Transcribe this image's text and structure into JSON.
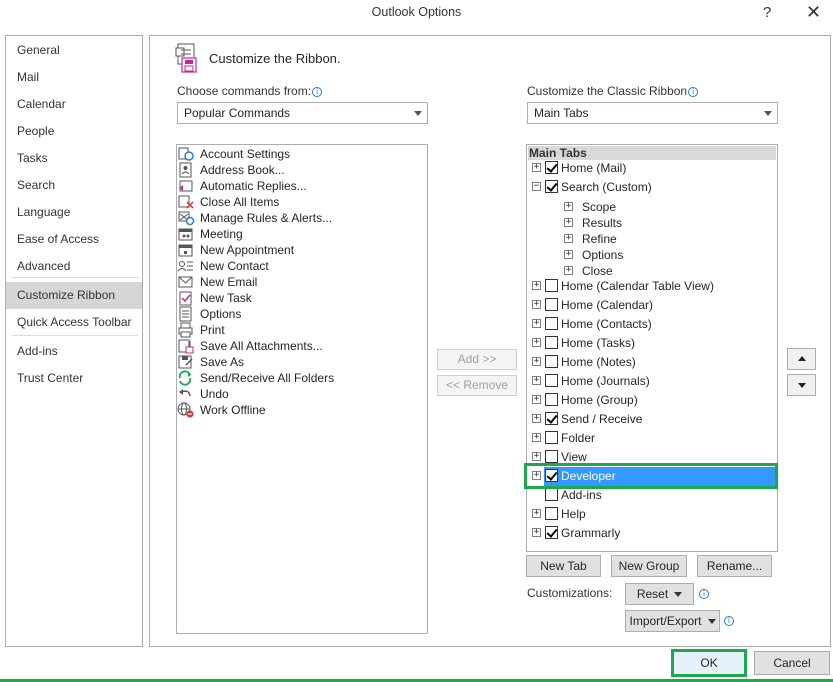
{
  "window": {
    "title": "Outlook Options",
    "help": "?",
    "close": "✕"
  },
  "nav": {
    "items": [
      "General",
      "Mail",
      "Calendar",
      "People",
      "Tasks",
      "Search",
      "Language",
      "Ease of Access",
      "Advanced",
      "Customize Ribbon",
      "Quick Access Toolbar",
      "Add-ins",
      "Trust Center"
    ],
    "selected": "Customize Ribbon"
  },
  "heading": "Customize the Ribbon.",
  "left": {
    "label": "Choose commands from:",
    "combo_value": "Popular Commands",
    "commands": [
      {
        "label": "Account Settings",
        "icon": "account-settings-icon"
      },
      {
        "label": "Address Book...",
        "icon": "address-book-icon"
      },
      {
        "label": "Automatic Replies...",
        "icon": "automatic-replies-icon"
      },
      {
        "label": "Close All Items",
        "icon": "close-all-items-icon"
      },
      {
        "label": "Manage Rules & Alerts...",
        "icon": "manage-rules-icon"
      },
      {
        "label": "Meeting",
        "icon": "meeting-icon"
      },
      {
        "label": "New Appointment",
        "icon": "new-appointment-icon"
      },
      {
        "label": "New Contact",
        "icon": "new-contact-icon"
      },
      {
        "label": "New Email",
        "icon": "new-email-icon"
      },
      {
        "label": "New Task",
        "icon": "new-task-icon"
      },
      {
        "label": "Options",
        "icon": "options-icon"
      },
      {
        "label": "Print",
        "icon": "print-icon"
      },
      {
        "label": "Save All Attachments...",
        "icon": "save-attachments-icon"
      },
      {
        "label": "Save As",
        "icon": "save-as-icon"
      },
      {
        "label": "Send/Receive All Folders",
        "icon": "send-receive-icon"
      },
      {
        "label": "Undo",
        "icon": "undo-icon"
      },
      {
        "label": "Work Offline",
        "icon": "work-offline-icon"
      }
    ]
  },
  "middle": {
    "add": "Add >>",
    "remove": "<< Remove"
  },
  "right": {
    "label": "Customize the Classic Ribbon",
    "combo_value": "Main Tabs",
    "tree_header": "Main Tabs",
    "tabs": [
      {
        "label": "Home (Mail)",
        "checked": true,
        "expander": "+"
      },
      {
        "label": "Search (Custom)",
        "checked": true,
        "expander": "−"
      },
      {
        "label": "Home (Calendar Table View)",
        "checked": false,
        "expander": "+"
      },
      {
        "label": "Home (Calendar)",
        "checked": false,
        "expander": "+"
      },
      {
        "label": "Home (Contacts)",
        "checked": false,
        "expander": "+"
      },
      {
        "label": "Home (Tasks)",
        "checked": false,
        "expander": "+"
      },
      {
        "label": "Home (Notes)",
        "checked": false,
        "expander": "+"
      },
      {
        "label": "Home (Journals)",
        "checked": false,
        "expander": "+"
      },
      {
        "label": "Home (Group)",
        "checked": false,
        "expander": "+"
      },
      {
        "label": "Send / Receive",
        "checked": true,
        "expander": "+"
      },
      {
        "label": "Folder",
        "checked": false,
        "expander": "+"
      },
      {
        "label": "View",
        "checked": false,
        "expander": "+"
      },
      {
        "label": "Developer",
        "checked": true,
        "expander": "+",
        "selected": true
      },
      {
        "label": "Add-ins",
        "checked": false,
        "expander": ""
      },
      {
        "label": "Help",
        "checked": false,
        "expander": "+"
      },
      {
        "label": "Grammarly",
        "checked": true,
        "expander": "+"
      }
    ],
    "search_groups": [
      "Scope",
      "Results",
      "Refine",
      "Options",
      "Close"
    ],
    "new_tab": "New Tab",
    "new_group": "New Group",
    "rename": "Rename...",
    "customizations_label": "Customizations:",
    "reset": "Reset",
    "import_export": "Import/Export"
  },
  "footer": {
    "ok": "OK",
    "cancel": "Cancel"
  },
  "colors": {
    "selection": "#3399ff",
    "highlight_frame": "#1ba94c",
    "nav_selected": "#d6d6d6"
  }
}
